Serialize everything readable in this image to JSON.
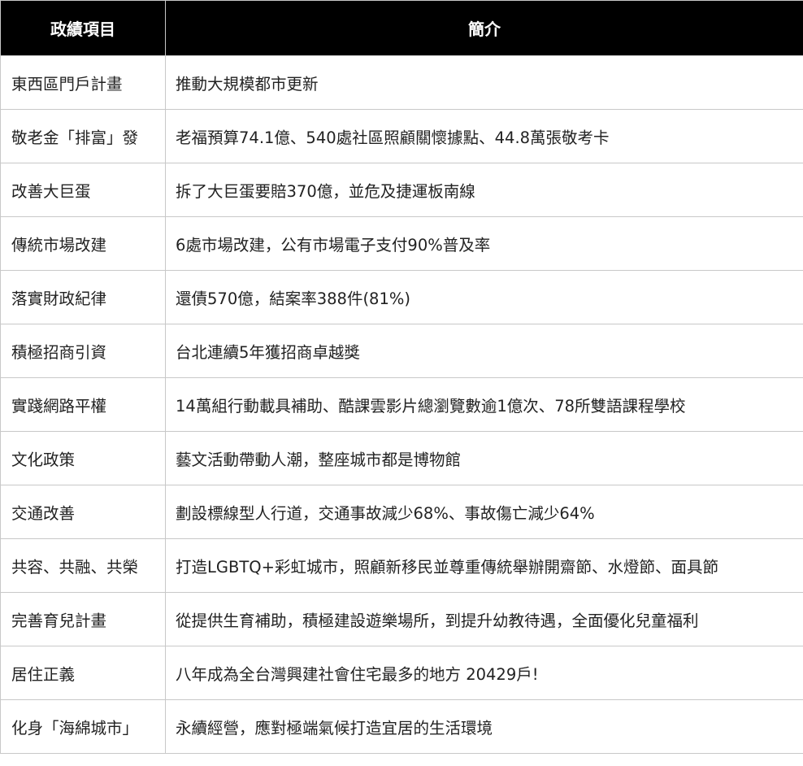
{
  "table": {
    "headers": [
      "政績項目",
      "簡介"
    ],
    "rows": [
      {
        "item": "東西區門戶計畫",
        "desc": "推動大規模都市更新"
      },
      {
        "item": "敬老金「排富」發",
        "desc": "老福預算74.1億、540處社區照顧關懷據點、44.8萬張敬考卡"
      },
      {
        "item": "改善大巨蛋",
        "desc": "拆了大巨蛋要賠370億，並危及捷運板南線"
      },
      {
        "item": "傳統市場改建",
        "desc": "6處市場改建，公有市場電子支付90%普及率"
      },
      {
        "item": "落實財政紀律",
        "desc": "還債570億，結案率388件(81%)"
      },
      {
        "item": "積極招商引資",
        "desc": "台北連續5年獲招商卓越獎"
      },
      {
        "item": "實踐網路平權",
        "desc": "14萬組行動載具補助、酷課雲影片總瀏覽數逾1億次、78所雙語課程學校"
      },
      {
        "item": "文化政策",
        "desc": "藝文活動帶動人潮，整座城市都是博物館"
      },
      {
        "item": "交通改善",
        "desc": "劃設標線型人行道，交通事故減少68%、事故傷亡減少64%"
      },
      {
        "item": "共容、共融、共榮",
        "desc": "打造LGBTQ+彩虹城市，照顧新移民並尊重傳統舉辦開齋節、水燈節、面具節"
      },
      {
        "item": "完善育兒計畫",
        "desc": "從提供生育補助，積極建設遊樂場所，到提升幼教待遇，全面優化兒童福利"
      },
      {
        "item": "居住正義",
        "desc": "八年成為全台灣興建社會住宅最多的地方 20429戶!"
      },
      {
        "item": "化身「海綿城市」",
        "desc": "永續經營，應對極端氣候打造宜居的生活環境"
      }
    ]
  }
}
